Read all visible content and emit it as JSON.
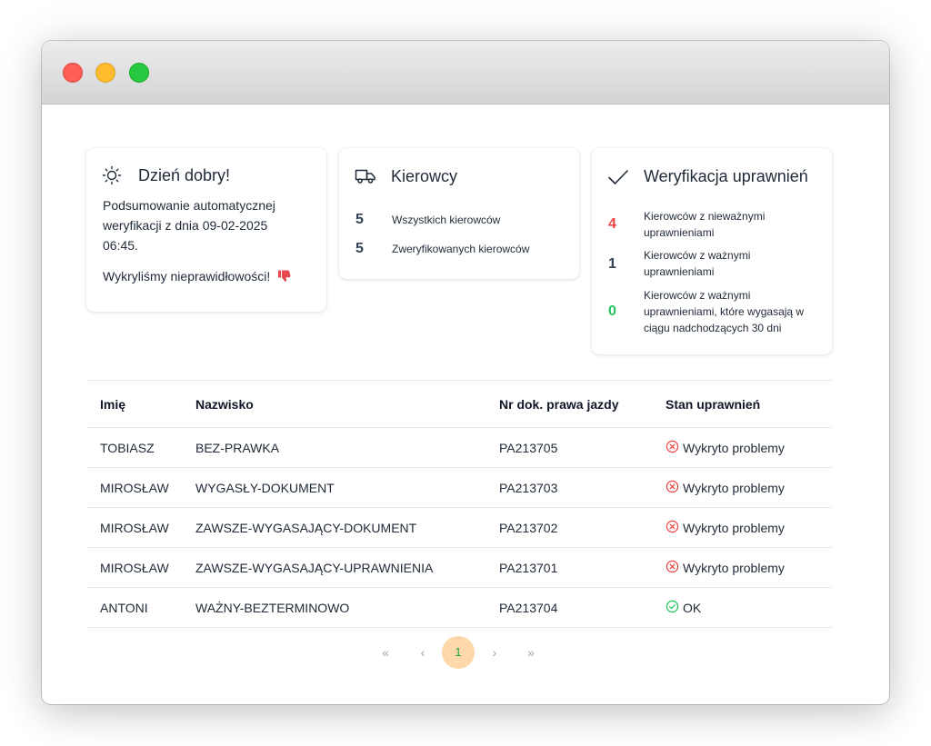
{
  "greeting": {
    "title": "Dzień dobry!",
    "icon": "sun-icon",
    "summary": "Podsumowanie automatycznej weryfikacji z dnia 09-02-2025 06:45.",
    "warning": "Wykryliśmy nieprawidłowości!",
    "warning_icon": "thumbs-down-icon"
  },
  "drivers": {
    "title": "Kierowcy",
    "icon": "truck-icon",
    "stats": [
      {
        "value": "5",
        "label": "Wszystkich kierowców"
      },
      {
        "value": "5",
        "label": "Zweryfikowanych kierowców"
      }
    ]
  },
  "verification": {
    "title": "Weryfikacja uprawnień",
    "icon": "check-icon",
    "stats": [
      {
        "value": "4",
        "label": "Kierowców z nieważnymi uprawnieniami",
        "color": "#ef4444"
      },
      {
        "value": "1",
        "label": "Kierowców z ważnymi uprawnieniami",
        "color": "#334155"
      },
      {
        "value": "0",
        "label": "Kierowców z ważnymi uprawnieniami, które wygasają w ciągu nadchodzących 30 dni",
        "color": "#22c55e"
      }
    ]
  },
  "table": {
    "headers": [
      "Imię",
      "Nazwisko",
      "Nr dok. prawa jazdy",
      "Stan uprawnień"
    ],
    "rows": [
      {
        "first": "TOBIASZ",
        "last": "BEZ-PRAWKA",
        "doc": "PA213705",
        "status": "Wykryto problemy",
        "status_type": "error"
      },
      {
        "first": "MIROSŁAW",
        "last": "WYGASŁY-DOKUMENT",
        "doc": "PA213703",
        "status": "Wykryto problemy",
        "status_type": "error"
      },
      {
        "first": "MIROSŁAW",
        "last": "ZAWSZE-WYGASAJĄCY-DOKUMENT",
        "doc": "PA213702",
        "status": "Wykryto problemy",
        "status_type": "error"
      },
      {
        "first": "MIROSŁAW",
        "last": "ZAWSZE-WYGASAJĄCY-UPRAWNIENIA",
        "doc": "PA213701",
        "status": "Wykryto problemy",
        "status_type": "error"
      },
      {
        "first": "ANTONI",
        "last": "WAŻNY-BEZTERMINOWO",
        "doc": "PA213704",
        "status": "OK",
        "status_type": "ok"
      }
    ]
  },
  "pagination": {
    "first": "«",
    "prev": "‹",
    "current": "1",
    "next": "›",
    "last": "»"
  },
  "colors": {
    "error": "#ef4444",
    "ok": "#22c55e",
    "active_page_bg": "#fed7aa"
  }
}
